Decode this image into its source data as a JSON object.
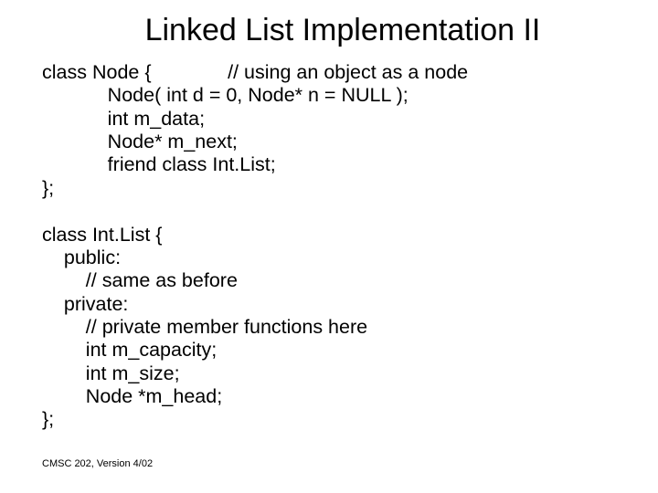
{
  "title": "Linked List Implementation II",
  "code_block1_l1": "class Node {              // using an object as a node",
  "code_block1_l2": "            Node( int d = 0, Node* n = NULL );",
  "code_block1_l3": "            int m_data;",
  "code_block1_l4": "            Node* m_next;",
  "code_block1_l5": "            friend class Int.List;",
  "code_block1_l6": "};",
  "code_block2_l1": "class Int.List {",
  "code_block2_l2": "    public:",
  "code_block2_l3": "        // same as before",
  "code_block2_l4": "    private:",
  "code_block2_l5": "        // private member functions here",
  "code_block2_l6": "        int m_capacity;",
  "code_block2_l7": "        int m_size;",
  "code_block2_l8": "        Node *m_head;",
  "code_block2_l9": "};",
  "footer": "CMSC 202, Version 4/02"
}
